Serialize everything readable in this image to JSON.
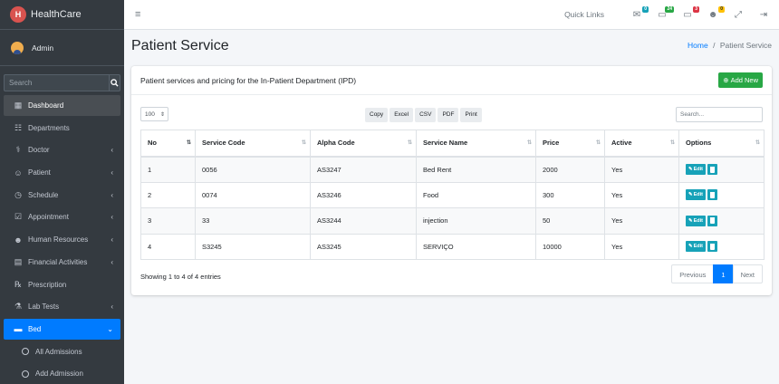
{
  "app": {
    "title": "HealthCare"
  },
  "user": {
    "name": "Admin"
  },
  "sidebar": {
    "search_placeholder": "Search",
    "items": [
      {
        "label": "Dashboard",
        "icon": "grid-icon"
      },
      {
        "label": "Departments",
        "icon": "sitemap-icon"
      },
      {
        "label": "Doctor",
        "icon": "doctor-icon"
      },
      {
        "label": "Patient",
        "icon": "user-icon"
      },
      {
        "label": "Schedule",
        "icon": "clock-icon"
      },
      {
        "label": "Appointment",
        "icon": "calendar-check-icon"
      },
      {
        "label": "Human Resources",
        "icon": "users-icon"
      },
      {
        "label": "Financial Activities",
        "icon": "money-icon"
      },
      {
        "label": "Prescription",
        "icon": "prescription-icon"
      },
      {
        "label": "Lab Tests",
        "icon": "flask-icon"
      },
      {
        "label": "Bed",
        "icon": "bed-icon"
      }
    ],
    "subitems": [
      {
        "label": "All Admissions"
      },
      {
        "label": "Add Admission"
      }
    ]
  },
  "topbar": {
    "quick_links": "Quick Links",
    "badges": [
      {
        "icon": "chat-icon",
        "count": "0",
        "color": "#17a2b8"
      },
      {
        "icon": "truck-icon",
        "count": "24",
        "color": "#28a745"
      },
      {
        "icon": "ambulance-icon",
        "count": "3",
        "color": "#dc3545"
      },
      {
        "icon": "user-alert-icon",
        "count": "0",
        "color": "#ffc107"
      }
    ]
  },
  "page": {
    "title": "Patient Service",
    "breadcrumb_home": "Home",
    "breadcrumb_sep": "/",
    "breadcrumb_current": "Patient Service"
  },
  "card": {
    "subtitle": "Patient services and pricing for the In-Patient Department (IPD)",
    "add_label": "Add New"
  },
  "table_controls": {
    "page_length": "100",
    "exports": [
      "Copy",
      "Excel",
      "CSV",
      "PDF",
      "Print"
    ],
    "search_placeholder": "Search..."
  },
  "table": {
    "headers": [
      "No",
      "Service Code",
      "Alpha Code",
      "Service Name",
      "Price",
      "Active",
      "Options"
    ],
    "rows": [
      [
        "1",
        "0056",
        "AS3247",
        "Bed Rent",
        "2000",
        "Yes"
      ],
      [
        "2",
        "0074",
        "AS3246",
        "Food",
        "300",
        "Yes"
      ],
      [
        "3",
        "33",
        "AS3244",
        "injection",
        "50",
        "Yes"
      ],
      [
        "4",
        "S3245",
        "AS3245",
        "SERVIÇO",
        "10000",
        "Yes"
      ]
    ],
    "edit_label": "Edit"
  },
  "footer": {
    "info": "Showing 1 to 4 of 4 entries",
    "previous": "Previous",
    "current_page": "1",
    "next": "Next"
  },
  "colors": {
    "sidebar": "#343a40",
    "accent": "#007bff",
    "success": "#28a745",
    "info": "#17a2b8"
  }
}
